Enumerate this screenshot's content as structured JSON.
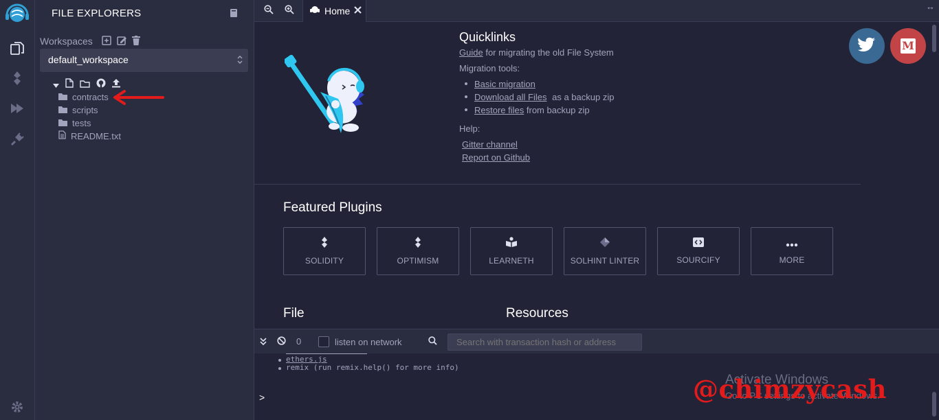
{
  "rail": {
    "items": [
      {
        "icon": "file-explorer-icon"
      },
      {
        "icon": "solidity-compiler-icon"
      },
      {
        "icon": "deploy-run-icon"
      },
      {
        "icon": "plugin-manager-icon"
      }
    ],
    "bottom_icon": "settings-gear-icon"
  },
  "sidebar": {
    "title": "FILE EXPLORERS",
    "workspaces_label": "Workspaces",
    "workspace_selected": "default_workspace",
    "tree": [
      {
        "type": "folder",
        "name": "contracts"
      },
      {
        "type": "folder",
        "name": "scripts"
      },
      {
        "type": "folder",
        "name": "tests"
      },
      {
        "type": "file",
        "name": "README.txt"
      }
    ]
  },
  "tabs": [
    {
      "label": "Home",
      "icon": "remix-logo-icon"
    }
  ],
  "home": {
    "quicklinks": {
      "title": "Quicklinks",
      "guide_link": "Guide",
      "guide_rest": "for migrating the old File System",
      "migration_label": "Migration tools:",
      "migration": [
        {
          "link": "Basic migration",
          "rest": ""
        },
        {
          "link": "Download all Files",
          "rest": "as a backup zip"
        },
        {
          "link": "Restore files",
          "rest": "from backup zip"
        }
      ],
      "help_label": "Help:",
      "help_links": [
        "Gitter channel",
        "Report on Github"
      ]
    },
    "social": [
      {
        "icon": "twitter-icon",
        "color": "#3a6a93"
      },
      {
        "icon": "medium-icon",
        "color": "#c24446"
      }
    ],
    "featured_title": "Featured Plugins",
    "plugins": [
      {
        "label": "SOLIDITY",
        "icon": "solidity-icon"
      },
      {
        "label": "OPTIMISM",
        "icon": "optimism-icon"
      },
      {
        "label": "LEARNETH",
        "icon": "learneth-icon"
      },
      {
        "label": "SOLHINT LINTER",
        "icon": "solhint-icon"
      },
      {
        "label": "SOURCIFY",
        "icon": "sourcify-icon"
      },
      {
        "label": "MORE",
        "icon": "more-dots-icon"
      }
    ],
    "file_title": "File",
    "resources_title": "Resources"
  },
  "terminal": {
    "count": "0",
    "listen_label": "listen on network",
    "search_placeholder": "Search with transaction hash or address",
    "lines": [
      "ethers.js",
      "remix (run remix.help() for more info)"
    ],
    "prompt": ">"
  },
  "overlay": {
    "activate_title": "Activate Windows",
    "activate_sub": "Go to PC settings to activate Windows.",
    "watermark": "@chimzycash"
  },
  "colors": {
    "background": "#222336",
    "panel": "#2a2c3f",
    "text": "#a2a3bd",
    "accent": "#2f9fd6",
    "annotation_arrow": "#e41b1b"
  }
}
